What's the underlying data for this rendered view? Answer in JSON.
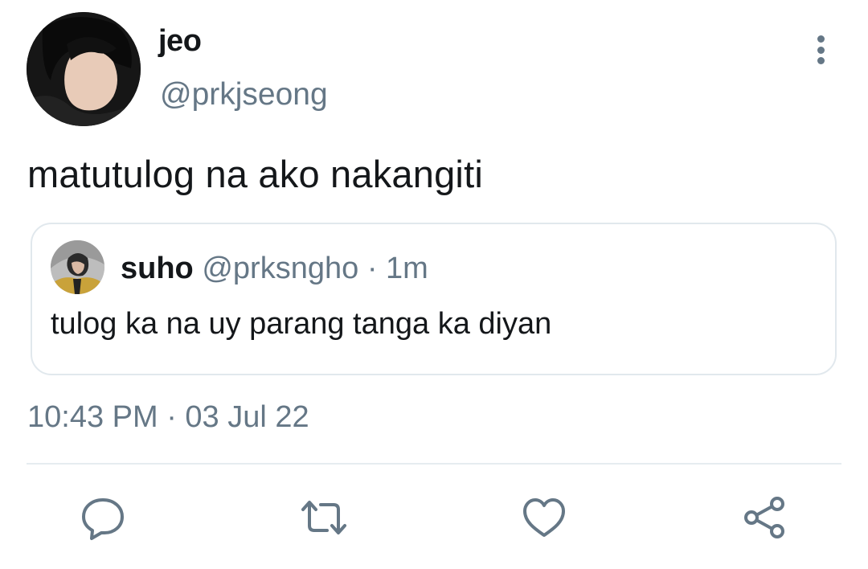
{
  "tweet": {
    "author_name": "jeo",
    "author_handle": "@prkjseong",
    "text": "matutulog na ako nakangiti",
    "timestamp": "10:43 PM · 03 Jul 22"
  },
  "quoted_tweet": {
    "author_name": "suho",
    "author_handle": "@prksngho",
    "separator": "·",
    "age": "1m",
    "text": "tulog ka na uy parang tanga ka diyan"
  },
  "actions": {
    "icons": [
      "reply-icon",
      "retweet-icon",
      "like-icon",
      "share-icon"
    ]
  },
  "colors": {
    "text": "#14171a",
    "secondary": "#657786",
    "border": "#e1e8ed"
  }
}
